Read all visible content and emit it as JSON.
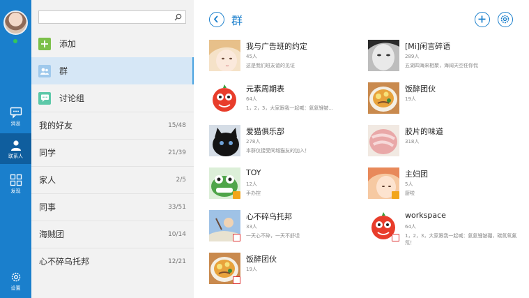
{
  "nav": {
    "items": [
      {
        "key": "messages",
        "label": "消息",
        "icon": "message-icon",
        "active": false
      },
      {
        "key": "contacts",
        "label": "联系人",
        "icon": "contact-icon",
        "active": true
      },
      {
        "key": "discover",
        "label": "发现",
        "icon": "grid-icon",
        "active": false
      },
      {
        "key": "settings",
        "label": "设置",
        "icon": "gear-icon",
        "active": false
      }
    ]
  },
  "contacts_panel": {
    "search_placeholder": "",
    "menu": [
      {
        "label": "添加",
        "icon": "add-icon",
        "color": "#7cc04a"
      },
      {
        "label": "群",
        "icon": "group-icon",
        "color": "#9fc9ec",
        "selected": true
      },
      {
        "label": "讨论组",
        "icon": "discussion-icon",
        "color": "#5cc8a8"
      }
    ],
    "friend_groups": [
      {
        "name": "我的好友",
        "count": "15/48"
      },
      {
        "name": "同学",
        "count": "21/39"
      },
      {
        "name": "家人",
        "count": "2/5"
      },
      {
        "name": "同事",
        "count": "33/51"
      },
      {
        "name": "海贼团",
        "count": "10/14"
      },
      {
        "name": "心不碎乌托邦",
        "count": "12/21"
      }
    ]
  },
  "main": {
    "title": "群",
    "accent": "#1a7fcc",
    "groups_left": [
      {
        "name": "我与广告班的约定",
        "members": "45人",
        "desc": "这是我们班友谊的见证",
        "thumb": "anime-girl",
        "badge": ""
      },
      {
        "name": "元素周期表",
        "members": "64人",
        "desc": "1，2，3，大家跟我一起喊：氦氦锂铍...",
        "thumb": "tomato-mascot",
        "badge": ""
      },
      {
        "name": "爱猫俱乐部",
        "members": "278人",
        "desc": "本群仅接受同城猫友的加入！",
        "thumb": "black-cat",
        "badge": ""
      },
      {
        "name": "TOY",
        "members": "12人",
        "desc": "手办控",
        "thumb": "green-toy",
        "badge": "pin"
      },
      {
        "name": "心不碎乌托邦",
        "members": "33人",
        "desc": "一天心不碎，一天不舒坦",
        "thumb": "drawing",
        "badge": "mute"
      },
      {
        "name": "饭醉团伙",
        "members": "19人",
        "desc": "",
        "thumb": "noodles",
        "badge": "mute"
      }
    ],
    "groups_right": [
      {
        "name": "[Mi]闲言碎语",
        "members": "289人",
        "desc": "五湖四海来相聚，海阔天空任你侃",
        "thumb": "bw-face",
        "badge": ""
      },
      {
        "name": "饭醉团伙",
        "members": "19人",
        "desc": "",
        "thumb": "noodles",
        "badge": ""
      },
      {
        "name": "胶片的味道",
        "members": "318人",
        "desc": "",
        "thumb": "meat",
        "badge": ""
      },
      {
        "name": "主妇团",
        "members": "5人",
        "desc": "厨啦",
        "thumb": "woman",
        "badge": "pin"
      },
      {
        "name": "workspace",
        "members": "64人",
        "desc": "1，2，3，大家跟我一起喊：氦氦锂铍硼，碳氮氧氟氖！",
        "thumb": "tomato-mascot",
        "badge": "mute"
      }
    ]
  }
}
